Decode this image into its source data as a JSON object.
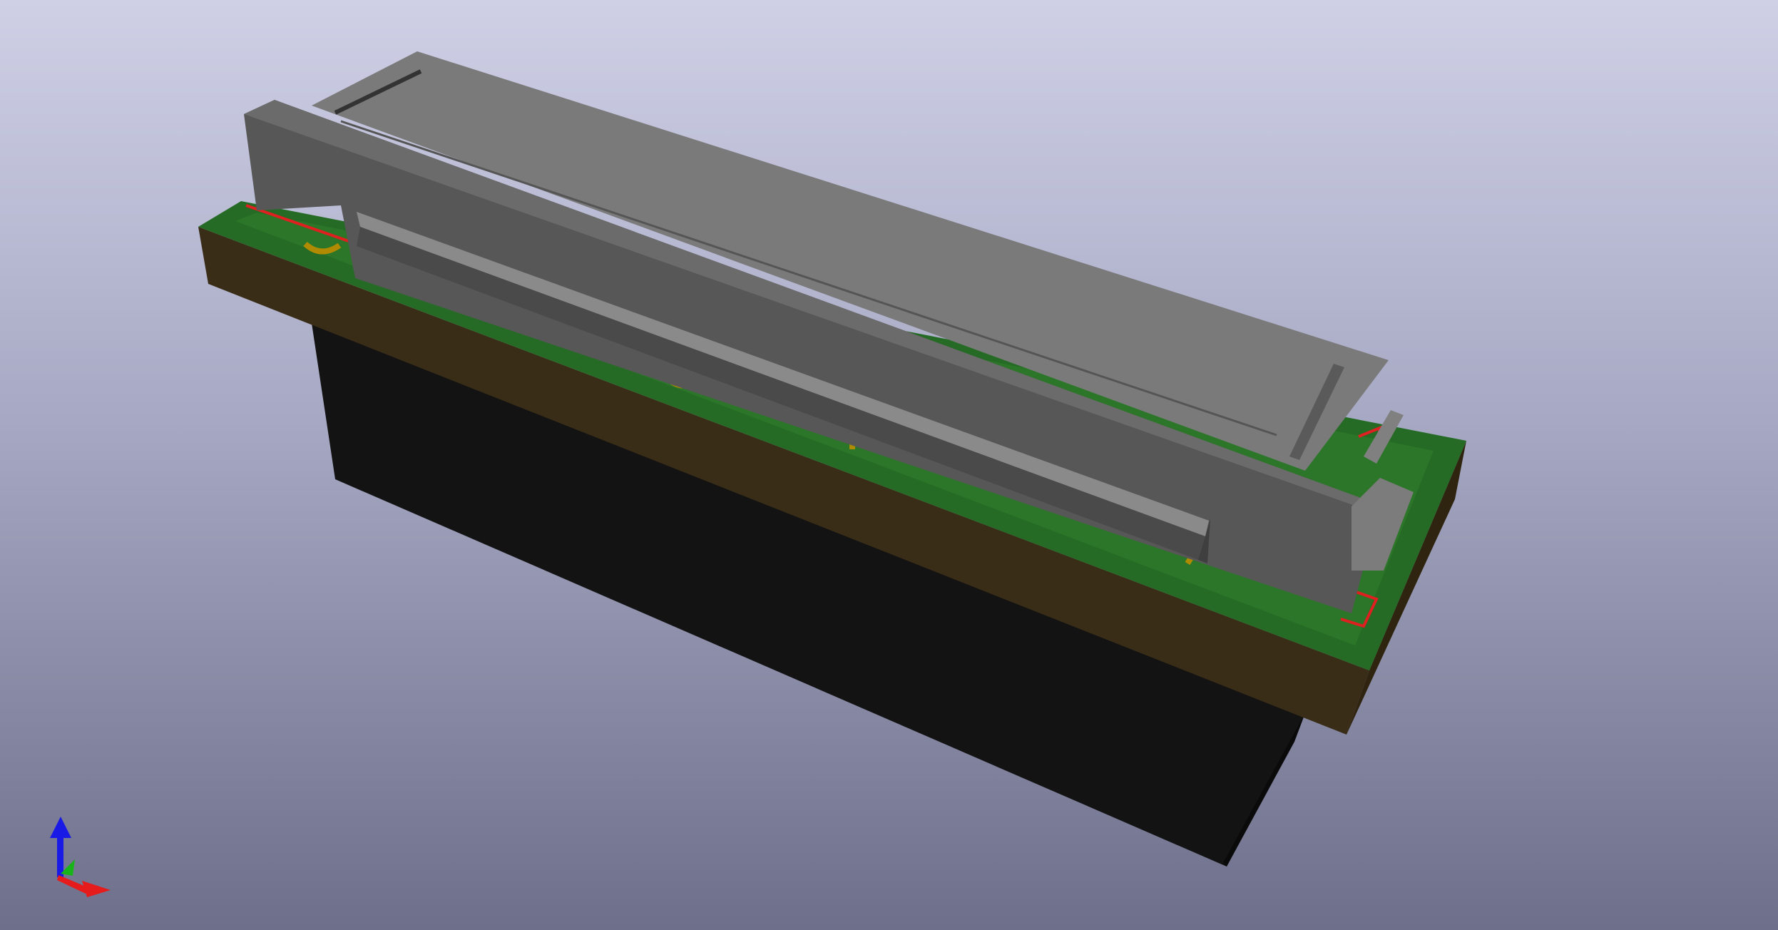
{
  "viewer": {
    "background_top": "#cfd0e6",
    "background_bottom": "#6e6f8a"
  },
  "model": {
    "connector_body_color": "#7a7a7a",
    "connector_face_color": "#575757",
    "pcb_top_color": "#256b25",
    "pcb_edge_color": "#3a2d17",
    "silkscreen_outline_color": "#e02020",
    "pad_color": "#b08a00",
    "underside_block_color": "#131313"
  },
  "axes_gizmo": {
    "x_axis_color": "#e61b1b",
    "y_axis_color": "#19b419",
    "z_axis_color": "#1a1ae6",
    "icon": "xyz-axes-icon"
  }
}
